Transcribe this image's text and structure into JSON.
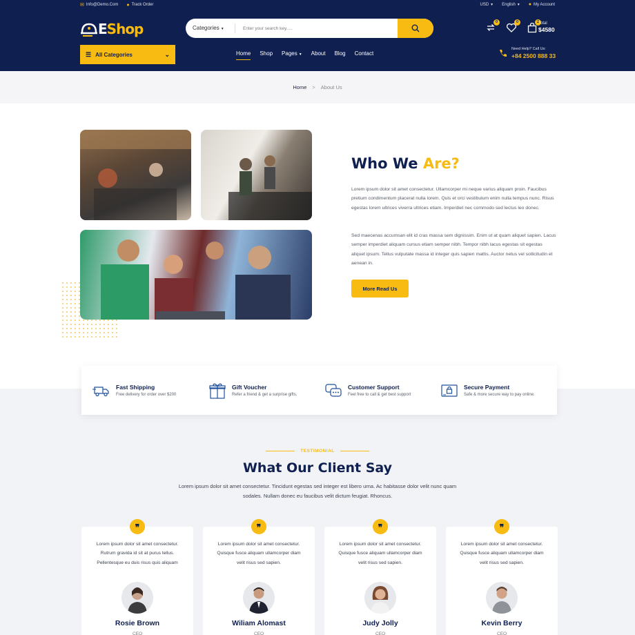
{
  "colors": {
    "navy": "#0f1f4f",
    "accent": "#f8bb12",
    "light_bg": "#f2f3f7"
  },
  "topbar": {
    "email": "Info@Demo.Com",
    "track": "Track Order",
    "currency": "USD",
    "language": "English",
    "account": "My Account"
  },
  "header": {
    "logo_white": "E",
    "logo_yellow": "Shop",
    "search_category": "Categories",
    "search_placeholder": "Enter your search key.....",
    "badges": {
      "compare": "0",
      "wishlist": "0",
      "cart": "2"
    },
    "total_label": "Total",
    "total_value": "$4580",
    "all_categories": "All Categories",
    "nav": [
      "Home",
      "Shop",
      "Pages",
      "About",
      "Blog",
      "Contact"
    ],
    "help_label": "Need Help? Call Us:",
    "help_phone": "+84 2500 888 33"
  },
  "breadcrumb": {
    "home": "Home",
    "sep": ">",
    "current": "About Us"
  },
  "about": {
    "title_a": "Who We ",
    "title_b": "Are?",
    "para1": "Lorem ipsum dolor sit amet consectetur. Ullamcorper mi neque varius aliquam proin. Faucibus pretium condimentum placerat nulla lorem. Quis et orci vestibulum enim nulla tempus nunc. Risus egestas lorem ultrices viverra ultrices etiam. Imperdiet nec commodo sed lectus leo donec.",
    "para2": "Sed maecenas accumsan elit id cras massa sem dignissim. Enim ut at quam aliquet sapien. Lacus semper imperdiet aliquam cursus etiam semper nibh. Tempor nibh lacus egestas sit egestas aliquet ipsum. Tellus vulputate massa id integer quis sapien mattis. Auctor netus vel sollicitudin et aenean in.",
    "button": "More Read Us"
  },
  "features": [
    {
      "title": "Fast Shipping",
      "sub": "Free delivery for order over $200",
      "icon": "truck-icon"
    },
    {
      "title": "Gift Voucher",
      "sub": "Refer a friend & get a surprise gifts.",
      "icon": "gift-icon"
    },
    {
      "title": "Customer Support",
      "sub": "Feel free to call & get best support",
      "icon": "support-icon"
    },
    {
      "title": "Secure Payment",
      "sub": "Safe & more secure way to pay online.",
      "icon": "card-lock-icon"
    }
  ],
  "testimonials": {
    "eyebrow": "TESTIMONIAL",
    "title": "What Our Client Say",
    "sub": "Lorem ipsum dolor sit amet consectetur. Tincidunt egestas sed integer est libero urna. Ac habitasse dolor velit nunc quam sodales. Nullam donec eu faucibus velit dictum feugiat. Rhoncus.",
    "items": [
      {
        "text": "Lorem ipsum dolor sit amet consectetur. Rutrum gravida id sit at purus tellus. Pellentesque eu duis risus quis aliquam",
        "name": "Rosie Brown",
        "role": "CEO"
      },
      {
        "text": "Lorem ipsum dolor sit amet consectetur. Quisque fusce aliquam ullamcorper diam velit risus sed sapien.",
        "name": "Wiliam Alomast",
        "role": "CEO"
      },
      {
        "text": "Lorem ipsum dolor sit amet consectetur. Quisque fusce aliquam ullamcorper diam velit risus sed sapien.",
        "name": "Judy Jolly",
        "role": "CEO"
      },
      {
        "text": "Lorem ipsum dolor sit amet consectetur. Quisque fusce aliquam ullamcorper diam velit risus sed sapien.",
        "name": "Kevin Berry",
        "role": "CEO"
      }
    ]
  }
}
